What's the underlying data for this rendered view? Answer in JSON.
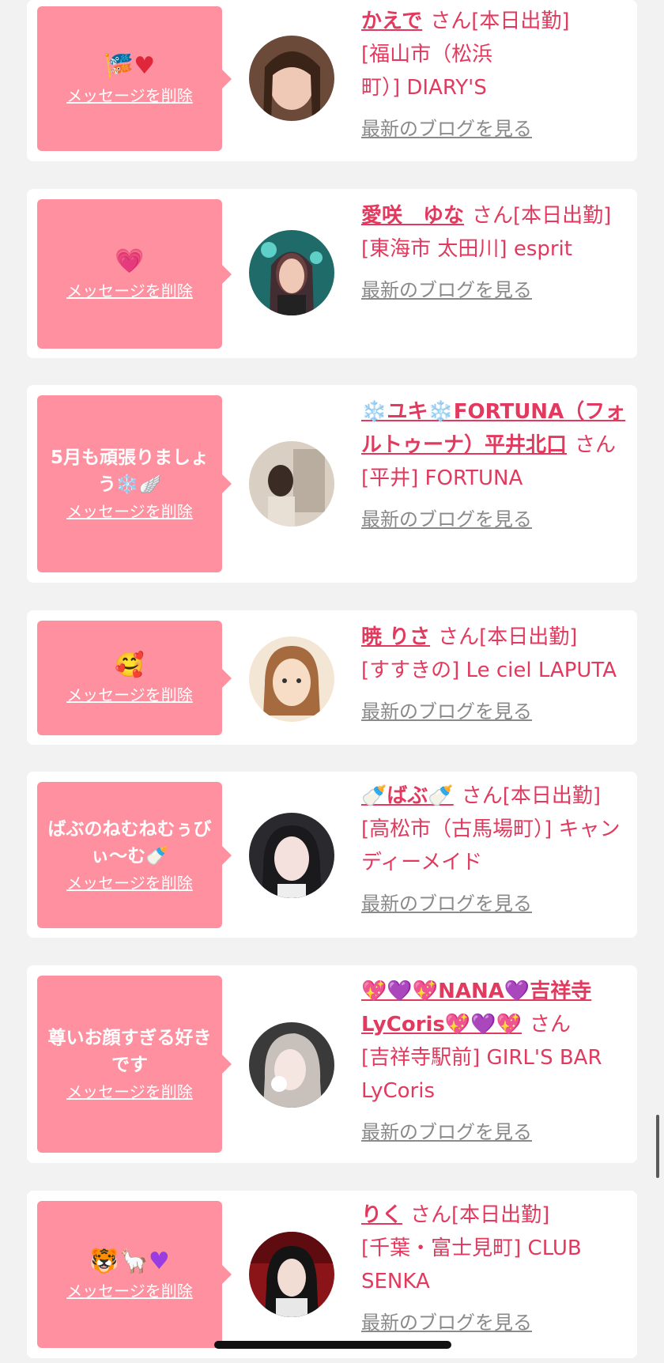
{
  "ui": {
    "delete_label": "メッセージを削除",
    "blog_label": "最新のブログを見る",
    "san": "さん"
  },
  "cards": [
    {
      "emoji_icons": [
        "koinobori-icon",
        "red-heart-icon"
      ],
      "name": "かえで",
      "status": "[本日出勤]",
      "location": "[福山市（松浜町）] DIARY'S"
    },
    {
      "emoji_icons": [
        "sparkling-heart-icon"
      ],
      "name": "愛咲　ゆな",
      "status": "[本日出勤]",
      "location": "[東海市 太田川] esprit"
    },
    {
      "message": "5月も頑張りましょう❄️🪽",
      "name": "❄️ユキ❄️FORTUNA（フォルトゥーナ）平井北口",
      "status": "",
      "location": "[平井] FORTUNA"
    },
    {
      "emoji_icons": [
        "smiling-face-with-hearts-icon"
      ],
      "name": "暁 りさ",
      "status": "[本日出勤]",
      "location": "[すすきの] Le ciel LAPUTA"
    },
    {
      "message": "ばぶのねむねむぅびぃ〜む🍼",
      "name": "🍼ばぶ🍼",
      "status": "[本日出勤]",
      "location": "[高松市（古馬場町）] キャンディーメイド"
    },
    {
      "message": "尊いお顔すぎる好きです",
      "name": "💖💜💖NANA💜吉祥寺LyCoris💖💜💖",
      "status": "",
      "location": "[吉祥寺駅前] GIRL'S BAR LyCoris"
    },
    {
      "emoji_icons": [
        "tiger-icon",
        "llama-icon",
        "purple-heart-icon"
      ],
      "name": "りく",
      "status": "[本日出勤]",
      "location": "[千葉・富士見町] CLUB SENKA"
    }
  ]
}
